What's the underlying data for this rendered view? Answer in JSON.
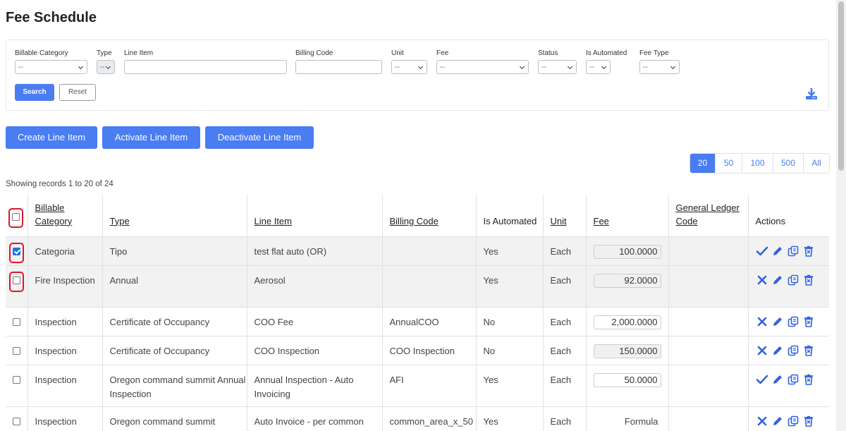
{
  "page": {
    "title": "Fee Schedule"
  },
  "filters": {
    "billable_category": {
      "label": "Billable Category",
      "value": "--"
    },
    "type": {
      "label": "Type",
      "value": "--"
    },
    "line_item": {
      "label": "Line Item",
      "value": ""
    },
    "billing_code": {
      "label": "Billing Code",
      "value": ""
    },
    "unit": {
      "label": "Unit",
      "value": "--"
    },
    "fee": {
      "label": "Fee",
      "value": "--"
    },
    "status": {
      "label": "Status",
      "value": "--"
    },
    "is_automated": {
      "label": "Is Automated",
      "value": "--"
    },
    "fee_type": {
      "label": "Fee Type",
      "value": "--"
    },
    "search_label": "Search",
    "reset_label": "Reset",
    "download_icon": "download-icon"
  },
  "toolbar": {
    "create_label": "Create Line Item",
    "activate_label": "Activate Line Item",
    "deactivate_label": "Deactivate Line Item"
  },
  "pager": {
    "sizes": [
      "20",
      "50",
      "100",
      "500",
      "All"
    ],
    "active": "20"
  },
  "records_text": "Showing records 1 to 20 of 24",
  "table": {
    "headers": {
      "billable_category": "Billable Category",
      "type": "Type",
      "line_item": "Line Item",
      "billing_code": "Billing Code",
      "is_automated": "Is Automated",
      "unit": "Unit",
      "fee": "Fee",
      "gl_code": "General Ledger Code",
      "actions": "Actions"
    },
    "rows": [
      {
        "checked": true,
        "category": "Categoria",
        "type": "Tipo",
        "line_item": "test flat auto (OR)",
        "billing_code": "",
        "automated": "Yes",
        "unit": "Each",
        "fee": "100.0000",
        "fee_style": "readonly",
        "gl_code": "",
        "toggle": "check"
      },
      {
        "checked": false,
        "category": "Fire Inspection",
        "type": "Annual",
        "line_item": "Aerosol",
        "billing_code": "",
        "automated": "Yes",
        "unit": "Each",
        "fee": "92.0000",
        "fee_style": "readonly",
        "gl_code": "",
        "toggle": "x"
      },
      {
        "checked": false,
        "category": "Inspection",
        "type": "Certificate of Occupancy",
        "line_item": "COO Fee",
        "billing_code": "AnnualCOO",
        "automated": "No",
        "unit": "Each",
        "fee": "2,000.0000",
        "fee_style": "editable",
        "gl_code": "",
        "toggle": "x"
      },
      {
        "checked": false,
        "category": "Inspection",
        "type": "Certificate of Occupancy",
        "line_item": "COO Inspection",
        "billing_code": "COO Inspection",
        "automated": "No",
        "unit": "Each",
        "fee": "150.0000",
        "fee_style": "readonly",
        "gl_code": "",
        "toggle": "x"
      },
      {
        "checked": false,
        "category": "Inspection",
        "type": "Oregon command summit Annual Inspection",
        "line_item": "Annual Inspection - Auto Invoicing",
        "billing_code": "AFI",
        "automated": "Yes",
        "unit": "Each",
        "fee": "50.0000",
        "fee_style": "editable",
        "gl_code": "",
        "toggle": "check"
      },
      {
        "checked": false,
        "category": "Inspection",
        "type": "Oregon command summit",
        "line_item": "Auto Invoice - per common",
        "billing_code": "common_area_x_50",
        "automated": "Yes",
        "unit": "Each",
        "fee": "Formula",
        "fee_style": "plain",
        "gl_code": "",
        "toggle": "x"
      }
    ]
  },
  "colors": {
    "accent": "#4a7cf2",
    "highlight_ring": "#e0162b",
    "row_shade": "#f2f2f2"
  }
}
